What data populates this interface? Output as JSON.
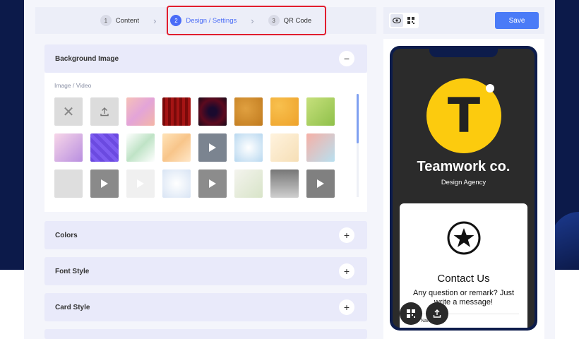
{
  "stepper": {
    "steps": [
      {
        "num": "1",
        "label": "Content"
      },
      {
        "num": "2",
        "label": "Design / Settings"
      },
      {
        "num": "3",
        "label": "QR Code"
      }
    ]
  },
  "toolbar": {
    "preview_icon": "eye-icon",
    "qr_icon": "qr-icon",
    "save_label": "Save"
  },
  "sections": {
    "background_image": {
      "title": "Background Image",
      "toggle": "−",
      "sublabel": "Image / Video"
    },
    "colors": {
      "title": "Colors",
      "toggle": "+"
    },
    "font_style": {
      "title": "Font Style",
      "toggle": "+"
    },
    "card_style": {
      "title": "Card Style",
      "toggle": "+"
    }
  },
  "preview": {
    "logo_letter": "T",
    "company": "Teamwork co.",
    "tagline": "Design Agency",
    "card_title": "Contact Us",
    "card_text": "Any question or remark? Just write a message!",
    "card_field": "Nam"
  },
  "colors": {
    "accent": "#4a7bf7",
    "logo_yellow": "#fccb0e",
    "highlight_red": "#e11d2e",
    "navy": "#0c1a4a"
  }
}
